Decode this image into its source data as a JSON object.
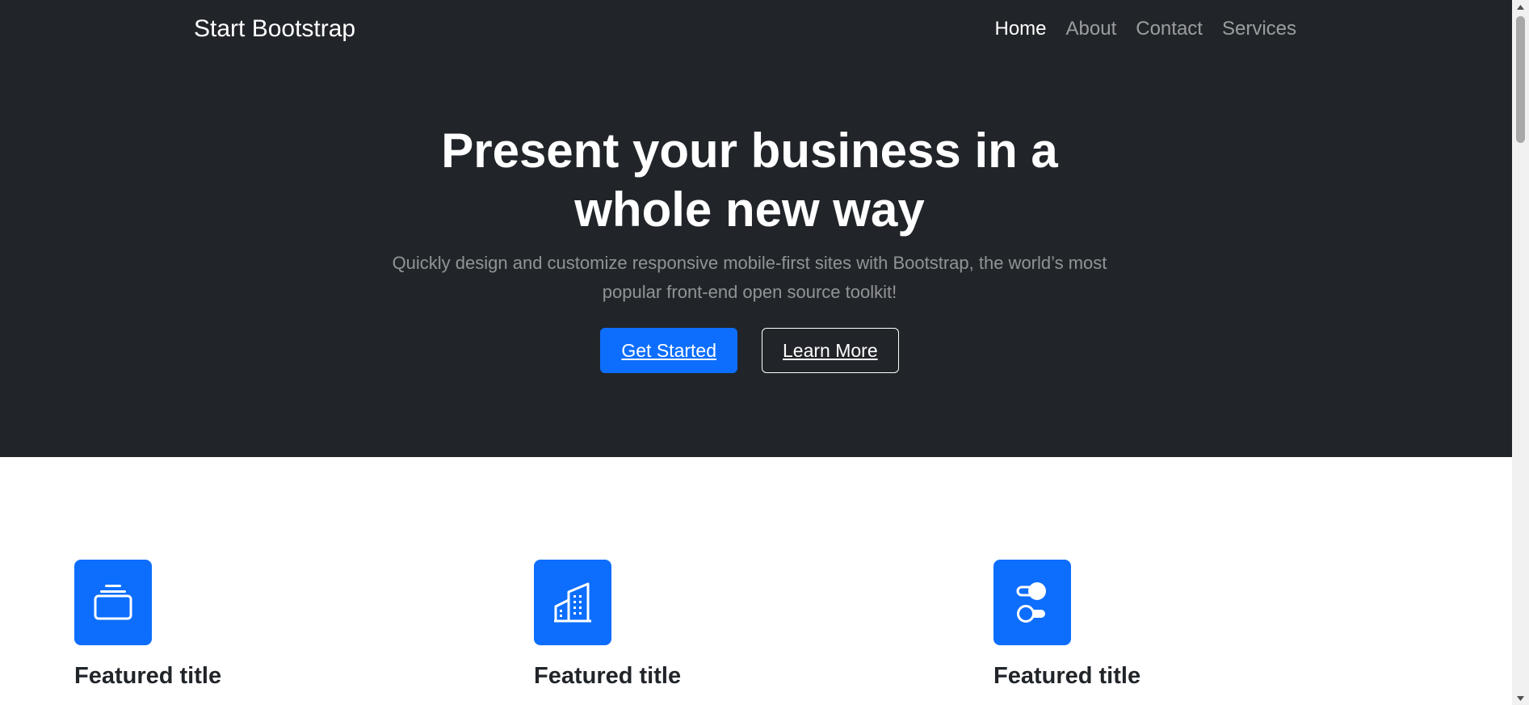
{
  "navbar": {
    "brand": "Start Bootstrap",
    "links": [
      {
        "label": "Home",
        "active": true
      },
      {
        "label": "About",
        "active": false
      },
      {
        "label": "Contact",
        "active": false
      },
      {
        "label": "Services",
        "active": false
      }
    ]
  },
  "hero": {
    "title": "Present your business in a whole new way",
    "lead": "Quickly design and customize responsive mobile-first sites with Bootstrap, the world’s most popular front-end open source toolkit!",
    "primary_button": "Get Started",
    "secondary_button": "Learn More"
  },
  "features": [
    {
      "icon": "collection-icon",
      "title": "Featured title"
    },
    {
      "icon": "building-icon",
      "title": "Featured title"
    },
    {
      "icon": "toggles-icon",
      "title": "Featured title"
    }
  ],
  "colors": {
    "dark": "#212529",
    "primary": "#0d6efd",
    "white": "#ffffff"
  }
}
